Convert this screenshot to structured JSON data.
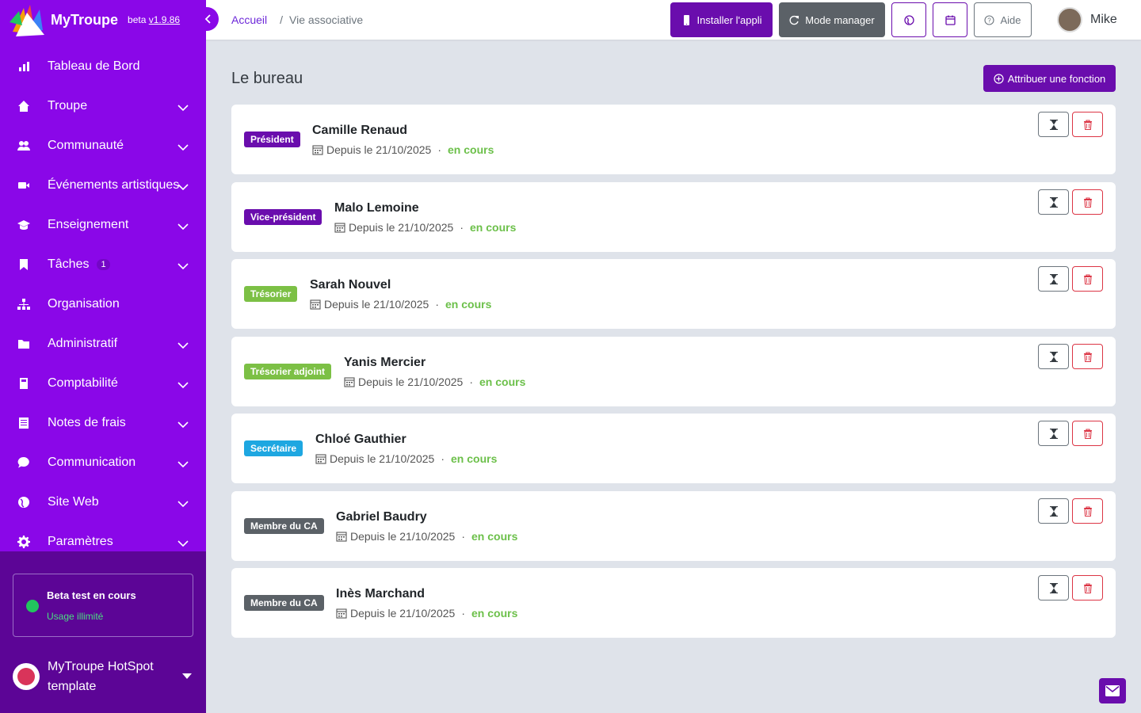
{
  "brand": {
    "name": "MyTroupe",
    "beta": "beta",
    "version": "v1.9.86"
  },
  "sidebar": {
    "items": [
      {
        "label": "Tableau de Bord",
        "icon": "chart-icon",
        "has_children": false
      },
      {
        "label": "Troupe",
        "icon": "home-icon",
        "has_children": true
      },
      {
        "label": "Communauté",
        "icon": "users-icon",
        "has_children": true
      },
      {
        "label": "Événements artistiques",
        "icon": "video-icon",
        "has_children": true
      },
      {
        "label": "Enseignement",
        "icon": "graduation-cap-icon",
        "has_children": true
      },
      {
        "label": "Tâches",
        "icon": "bookmark-icon",
        "has_children": true,
        "badge": "1"
      },
      {
        "label": "Organisation",
        "icon": "sitemap-icon",
        "has_children": false
      },
      {
        "label": "Administratif",
        "icon": "folder-icon",
        "has_children": true
      },
      {
        "label": "Comptabilité",
        "icon": "calculator-icon",
        "has_children": true
      },
      {
        "label": "Notes de frais",
        "icon": "receipt-icon",
        "has_children": true
      },
      {
        "label": "Communication",
        "icon": "chat-icon",
        "has_children": true
      },
      {
        "label": "Site Web",
        "icon": "globe-icon",
        "has_children": true
      },
      {
        "label": "Paramètres",
        "icon": "gear-icon",
        "has_children": true
      }
    ],
    "beta_box": {
      "title": "Beta test en cours",
      "subtitle": "Usage illimité"
    },
    "org": {
      "name": "MyTroupe HotSpot template"
    }
  },
  "topbar": {
    "breadcrumb": {
      "home": "Accueil",
      "separator": "/",
      "current": "Vie associative"
    },
    "install_label": "Installer l'appli",
    "manager_label": "Mode manager",
    "help_label": "Aide",
    "user_name": "Mike"
  },
  "main": {
    "title": "Le bureau",
    "assign_label": "Attribuer une fonction",
    "members": [
      {
        "role": "Président",
        "role_color": "#6a0dad",
        "name": "Camille Renaud",
        "since": "Depuis le 21/10/2025",
        "status": "en cours"
      },
      {
        "role": "Vice-président",
        "role_color": "#6a0dad",
        "name": "Malo Lemoine",
        "since": "Depuis le 21/10/2025",
        "status": "en cours"
      },
      {
        "role": "Trésorier",
        "role_color": "#7cc045",
        "name": "Sarah Nouvel",
        "since": "Depuis le 21/10/2025",
        "status": "en cours"
      },
      {
        "role": "Trésorier adjoint",
        "role_color": "#7cc045",
        "name": "Yanis Mercier",
        "since": "Depuis le 21/10/2025",
        "status": "en cours"
      },
      {
        "role": "Secrétaire",
        "role_color": "#1ea7e1",
        "name": "Chloé Gauthier",
        "since": "Depuis le 21/10/2025",
        "status": "en cours"
      },
      {
        "role": "Membre du CA",
        "role_color": "#5b6167",
        "name": "Gabriel Baudry",
        "since": "Depuis le 21/10/2025",
        "status": "en cours"
      },
      {
        "role": "Membre du CA",
        "role_color": "#5b6167",
        "name": "Inès Marchand",
        "since": "Depuis le 21/10/2025",
        "status": "en cours"
      }
    ]
  },
  "colors": {
    "sidebar": "#8a07e8",
    "sidebar_footer": "#5c0596",
    "primary": "#6a0dad",
    "status_green": "#6cc04a",
    "danger": "#dc3545"
  }
}
